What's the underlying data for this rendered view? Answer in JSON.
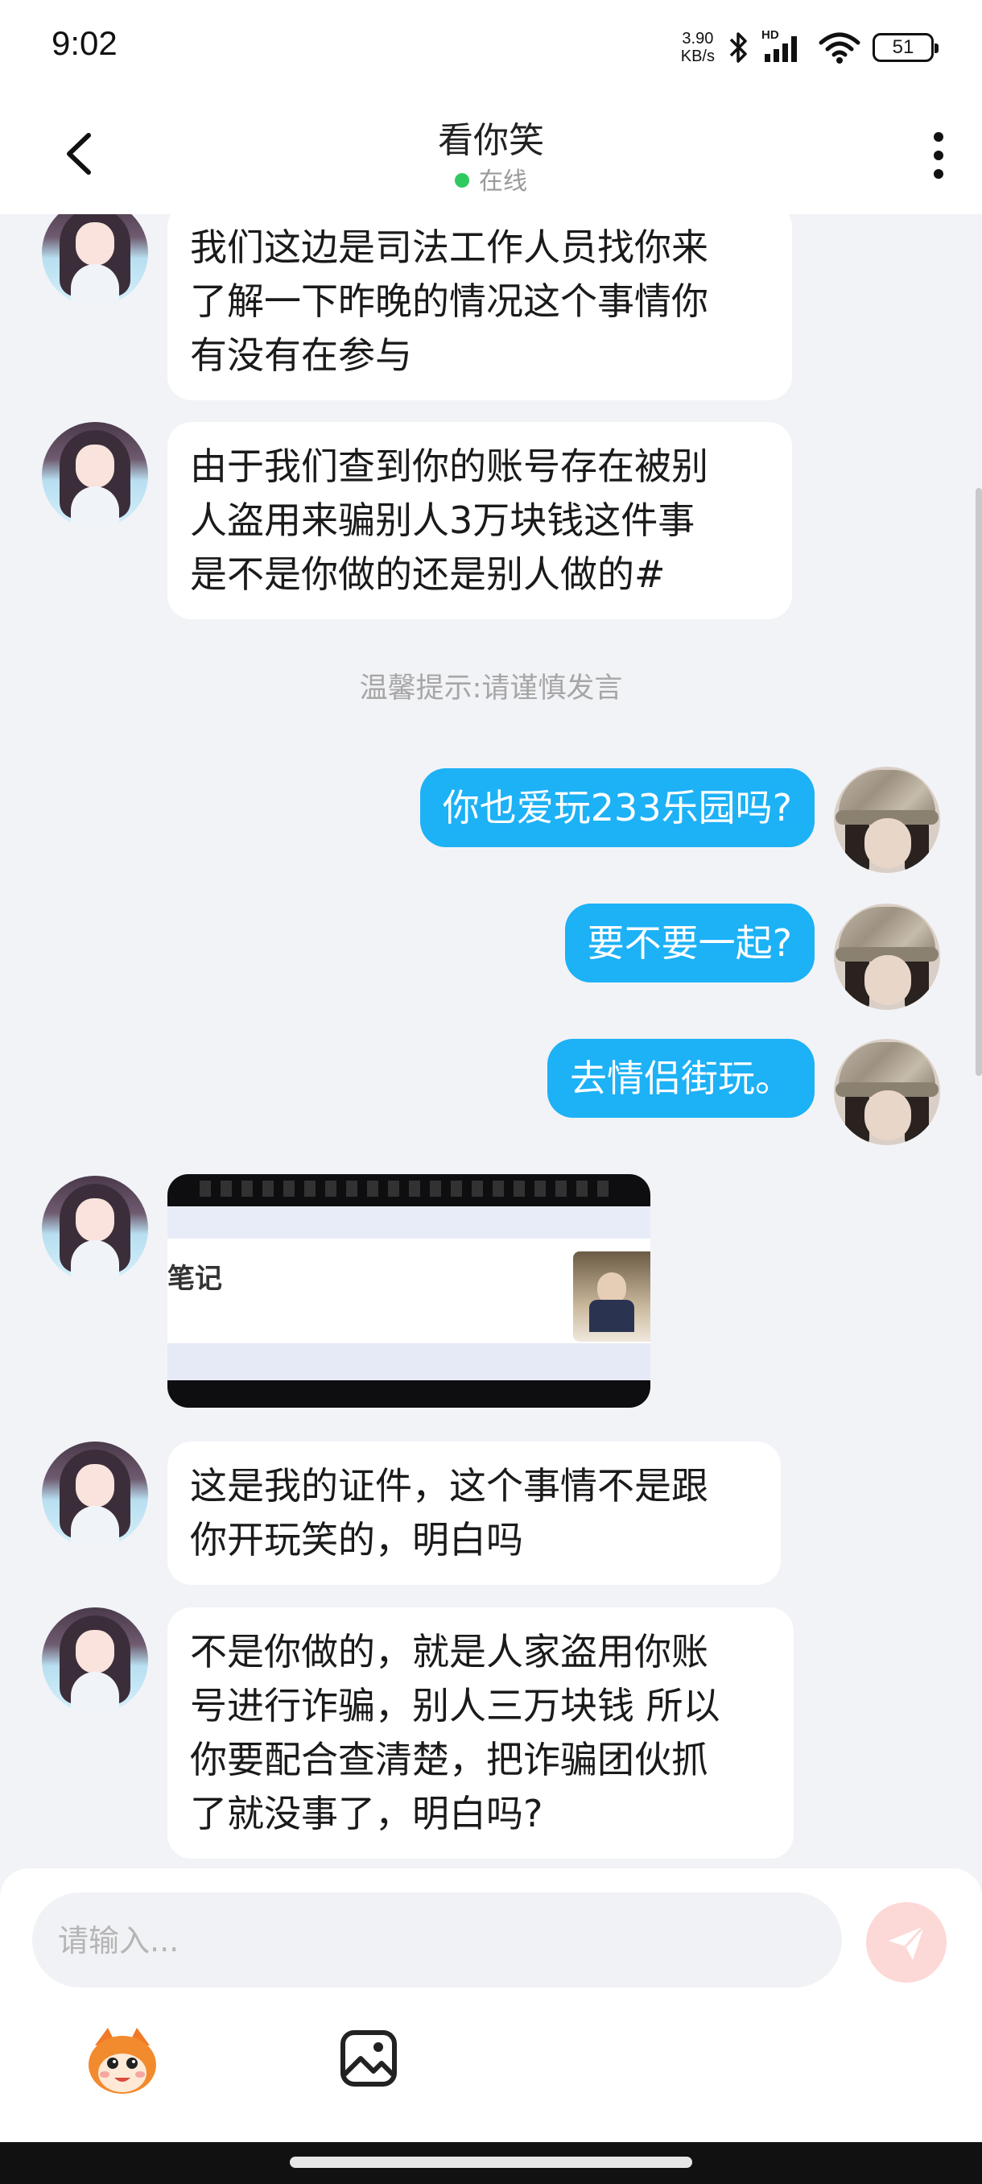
{
  "status_bar": {
    "time": "9:02",
    "net_speed_value": "3.90",
    "net_speed_unit": "KB/s",
    "hd_label": "HD",
    "battery": "51"
  },
  "header": {
    "title": "看你笑",
    "status": "在线",
    "status_color": "#2fca5f"
  },
  "messages": [
    {
      "from": "other",
      "lines": [
        "我们这边是司法工作人员找你来",
        "了解一下昨晚的情况这个事情你",
        "有没有在参与"
      ]
    },
    {
      "from": "other",
      "lines": [
        "由于我们查到你的账号存在被别",
        "人盗用来骗别人3万块钱这件事",
        "是不是你做的还是别人做的#"
      ]
    },
    {
      "from": "me",
      "text": "你也爱玩233乐园吗?"
    },
    {
      "from": "me",
      "text": "要不要一起?"
    },
    {
      "from": "me",
      "text": "去情侣街玩。"
    },
    {
      "from": "other",
      "type": "image",
      "visible_text": "笔记"
    },
    {
      "from": "other",
      "lines": [
        "这是我的证件，这个事情不是跟",
        "你开玩笑的，明白吗"
      ]
    },
    {
      "from": "other",
      "lines": [
        "不是你做的，就是人家盗用你账",
        "号进行诈骗，别人三万块钱 所以",
        "你要配合查清楚，把诈骗团伙抓",
        "了就没事了，明白吗?"
      ]
    }
  ],
  "system_tip": "温馨提示:请谨慎发言",
  "input": {
    "placeholder": "请输入..."
  },
  "icons": {
    "back": "chevron-left-icon",
    "more": "more-vertical-icon",
    "send": "paper-plane-icon",
    "mascot": "mascot-icon",
    "gallery": "image-gallery-icon"
  },
  "colors": {
    "outgoing_bubble": "#1db1f6",
    "incoming_bubble": "#ffffff",
    "background": "#f2f3f7",
    "send_button": "#fcd9d6"
  }
}
